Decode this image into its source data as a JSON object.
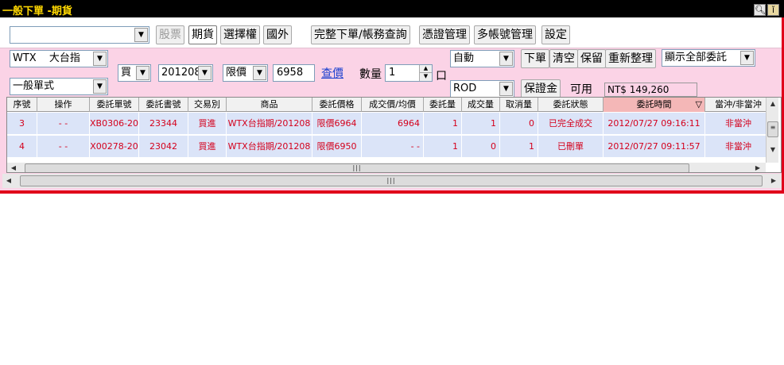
{
  "window": {
    "title": "一般下單 -期貨",
    "icons": [
      "magnifier-icon",
      "info-icon"
    ]
  },
  "toolbar": {
    "account_value": "",
    "buttons": [
      {
        "label": "股票",
        "state": "disabled"
      },
      {
        "label": "期貨",
        "state": "pressed"
      },
      {
        "label": "選擇權",
        "state": "normal"
      },
      {
        "label": "國外",
        "state": "normal"
      },
      {
        "label": "完整下單/帳務查詢",
        "state": "normal"
      },
      {
        "label": "憑證管理",
        "state": "normal"
      },
      {
        "label": "多帳號管理",
        "state": "normal"
      },
      {
        "label": "設定",
        "state": "normal"
      }
    ]
  },
  "order": {
    "product_code": "WTX",
    "product_name": "大台指",
    "order_type": "一般單式",
    "side": "買",
    "month": "201208",
    "price_type": "限價",
    "price": "6958",
    "query_price_link": "查價",
    "quantity_label": "數量",
    "quantity": "1",
    "unit": "口",
    "mode": "自動",
    "time_in_force": "ROD",
    "buttons": {
      "place": "下單",
      "clear": "清空",
      "keep": "保留",
      "rearrange": "重新整理",
      "margin": "保證金"
    },
    "filter": "顯示全部委託",
    "available_label": "可用",
    "available_value": "NT$ 149,260"
  },
  "grid": {
    "columns": [
      "序號",
      "操作",
      "委託單號",
      "委託書號",
      "交易別",
      "商品",
      "委託價格",
      "成交價/均價",
      "委託量",
      "成交量",
      "取消量",
      "委託狀態",
      "委託時間",
      "當沖/非當沖"
    ],
    "sorted_column": "委託時間",
    "sort_glyph": "▽",
    "rows": [
      [
        "3",
        "- -",
        "XB0306-20",
        "23344",
        "買進",
        "WTX台指期/201208",
        "限價6964",
        "6964",
        "1",
        "1",
        "0",
        "已完全成交",
        "2012/07/27  09:16:11",
        "非當沖"
      ],
      [
        "4",
        "- -",
        "X00278-20",
        "23042",
        "買進",
        "WTX台指期/201208",
        "限價6950",
        "- -",
        "1",
        "0",
        "1",
        "已刪單",
        "2012/07/27  09:11:57",
        "非當沖"
      ]
    ]
  },
  "colors": {
    "title_bg": "#000000",
    "title_text": "#ffd800",
    "panel_bg": "#fbd3e6",
    "row_bg": "#dbe4f8",
    "row_text": "#d4001c",
    "frame_red": "#e0001a",
    "sorted_header": "#f4b7b7"
  }
}
